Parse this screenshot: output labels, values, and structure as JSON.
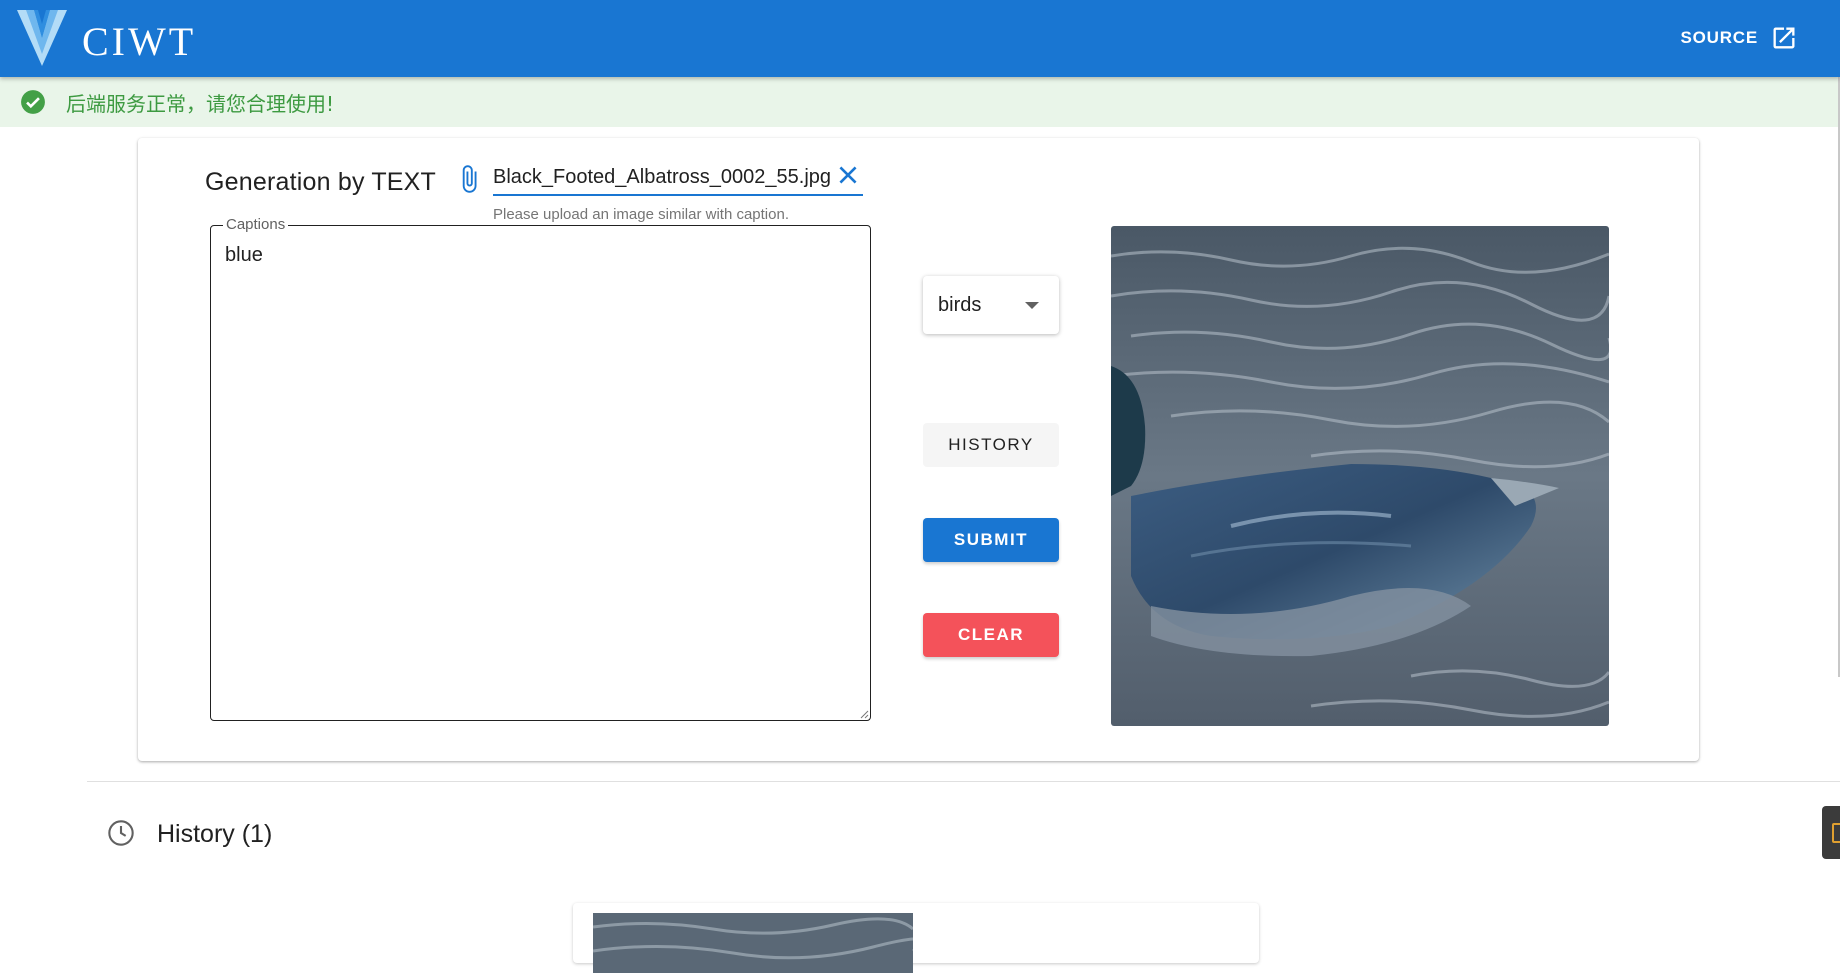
{
  "app": {
    "brand": "CIWT",
    "source_label": "SOURCE",
    "accent_color": "#1976d2"
  },
  "alert": {
    "message": "后端服务正常，请您合理使用!",
    "status": "success",
    "icon": "check-circle-icon"
  },
  "generator": {
    "title": "Generation by TEXT",
    "file": {
      "name": "Black_Footed_Albatross_0002_55.jpg",
      "hint": "Please upload an image similar with caption."
    },
    "captions": {
      "label": "Captions",
      "value": "blue"
    },
    "dataset_select": {
      "value": "birds"
    },
    "buttons": {
      "history": "HISTORY",
      "submit": "SUBMIT",
      "clear": "CLEAR"
    },
    "colors": {
      "submit": "#1976d2",
      "clear": "#f4525a"
    }
  },
  "history": {
    "title": "History (1)",
    "icon": "clock-icon"
  }
}
